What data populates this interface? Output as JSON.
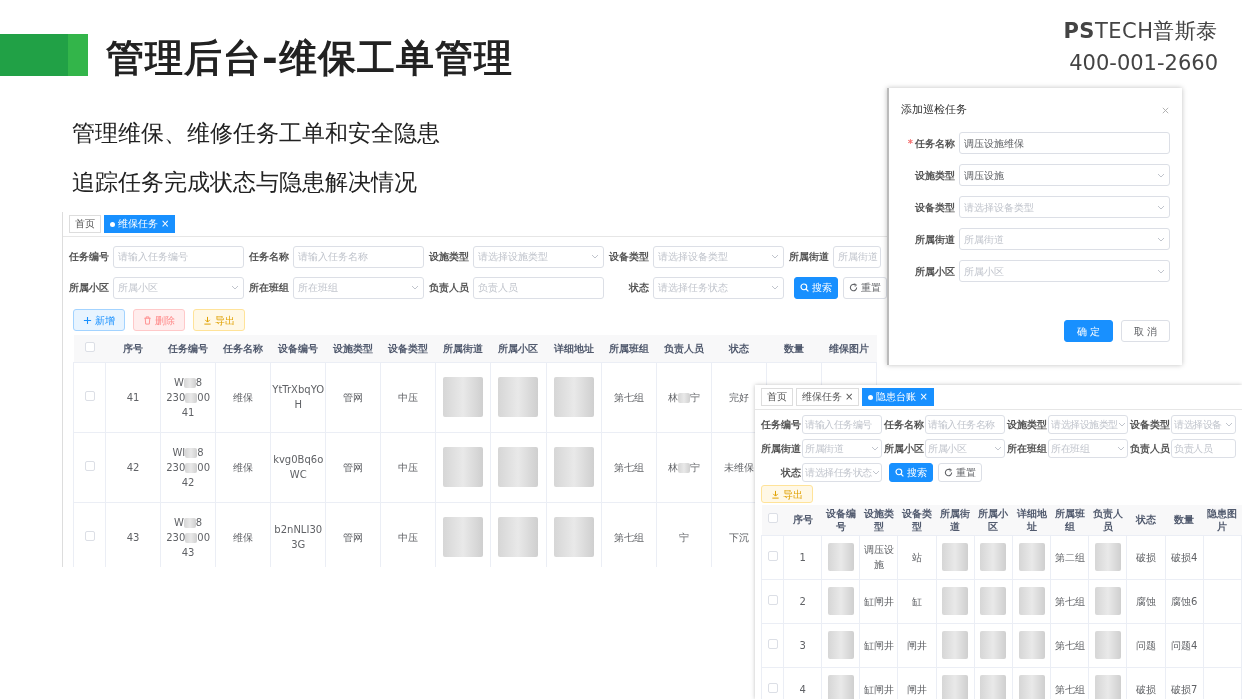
{
  "header": {
    "title": "管理后台-维保工单管理",
    "subtitles": [
      "管理维保、维修任务工单和安全隐患",
      "追踪任务完成状态与隐患解决情况"
    ],
    "logo": "**PS**TECH普斯泰",
    "phone": "400-001-2660"
  },
  "main_screen": {
    "tabs": [
      {
        "label": "首页",
        "selected": false
      },
      {
        "label": "维保任务",
        "selected": true,
        "close": "×"
      }
    ],
    "filter_rows": [
      [
        {
          "kind": "input",
          "label": "任务编号",
          "placeholder": "请输入任务编号"
        },
        {
          "kind": "input",
          "label": "任务名称",
          "placeholder": "请输入任务名称"
        },
        {
          "kind": "select",
          "label": "设施类型",
          "placeholder": "请选择设施类型"
        },
        {
          "kind": "select",
          "label": "设备类型",
          "placeholder": "请选择设备类型"
        },
        {
          "kind": "input",
          "label": "所属街道",
          "placeholder": "所属街道"
        }
      ],
      [
        {
          "kind": "select",
          "label": "所属小区",
          "placeholder": "所属小区"
        },
        {
          "kind": "select",
          "label": "所在班组",
          "placeholder": "所在班组"
        },
        {
          "kind": "input",
          "label": "负责人员",
          "placeholder": "负责人员"
        },
        {
          "kind": "select",
          "label": "状态",
          "placeholder": "请选择任务状态"
        },
        {
          "kind": "search",
          "label": "搜索"
        },
        {
          "kind": "reset",
          "label": "重置"
        }
      ]
    ],
    "actions": [
      {
        "kind": "add",
        "label": "新增"
      },
      {
        "kind": "delete",
        "label": "删除"
      },
      {
        "kind": "export",
        "label": "导出"
      }
    ],
    "table": {
      "select_all_checked": false,
      "columns": [
        "序号",
        "任务编号",
        "任务名称",
        "设备编号",
        "设施类型",
        "设备类型",
        "所属街道",
        "所属小区",
        "详细地址",
        "所属班组",
        "负责人员",
        "状态",
        "数量",
        "维保图片"
      ],
      "rows": [
        {
          "checked": false,
          "cells": [
            "41",
            {
              "lines": [
                [
                  "W",
                  "8"
                ],
                [
                  "230",
                  "00"
                ],
                [
                  "41"
                ]
              ]
            },
            "维保",
            "YtTrXbqYOH",
            "管网",
            "中压",
            {
              "redacted": true
            },
            {
              "redacted": true
            },
            {
              "redacted": true
            },
            "第七组",
            {
              "lines": [
                [
                  "林",
                  "宁"
                ]
              ]
            },
            "完好"
          ]
        },
        {
          "checked": false,
          "cells": [
            "42",
            {
              "lines": [
                [
                  "WI",
                  "8"
                ],
                [
                  "230",
                  "00"
                ],
                [
                  "42"
                ]
              ]
            },
            "维保",
            "kvg0Bq6oWC",
            "管网",
            "中压",
            {
              "redacted": true
            },
            {
              "redacted": true
            },
            {
              "redacted": true
            },
            "第七组",
            {
              "lines": [
                [
                  "林",
                  "宁"
                ]
              ]
            },
            "未维保"
          ]
        },
        {
          "checked": false,
          "cells": [
            "43",
            {
              "lines": [
                [
                  "W",
                  "8"
                ],
                [
                  "230",
                  "00"
                ],
                [
                  "43"
                ]
              ]
            },
            "维保",
            "b2nNLI303G",
            "管网",
            "中压",
            {
              "redacted": true
            },
            {
              "redacted": true
            },
            {
              "redacted": true
            },
            "第七组",
            {
              "lines": [
                [
                  "宁"
                ]
              ]
            },
            "下沉"
          ]
        }
      ]
    }
  },
  "dialog": {
    "title": "添加巡检任务",
    "fields": [
      {
        "kind": "input",
        "label": "任务名称",
        "required_mark": "*",
        "value": "调压设施维保"
      },
      {
        "kind": "select",
        "label": "设施类型",
        "value": "调压设施"
      },
      {
        "kind": "select",
        "label": "设备类型",
        "placeholder": "请选择设备类型"
      },
      {
        "kind": "select",
        "label": "所属街道",
        "placeholder": "所属街道"
      },
      {
        "kind": "select",
        "label": "所属小区",
        "placeholder": "所属小区"
      }
    ],
    "buttons": [
      {
        "kind": "primary",
        "label": "确 定"
      },
      {
        "kind": "default",
        "label": "取 消"
      }
    ]
  },
  "hazard_screen": {
    "tabs": [
      {
        "label": "首页",
        "selected": false
      },
      {
        "label": "维保任务",
        "selected": false,
        "close": "×"
      },
      {
        "label": "隐患台账",
        "selected": true,
        "close": "×"
      }
    ],
    "filter_rows": [
      [
        {
          "kind": "input",
          "label": "任务编号",
          "placeholder": "请输入任务编号"
        },
        {
          "kind": "input",
          "label": "任务名称",
          "placeholder": "请输入任务名称"
        },
        {
          "kind": "select",
          "label": "设施类型",
          "placeholder": "请选择设施类型"
        },
        {
          "kind": "select",
          "label": "设备类型",
          "placeholder": "请选择设备"
        }
      ],
      [
        {
          "kind": "select",
          "label": "所属街道",
          "placeholder": "所属街道"
        },
        {
          "kind": "select",
          "label": "所属小区",
          "placeholder": "所属小区"
        },
        {
          "kind": "select",
          "label": "所在班组",
          "placeholder": "所在班组"
        },
        {
          "kind": "input",
          "label": "负责人员",
          "placeholder": "负责人员"
        }
      ],
      [
        {
          "kind": "select",
          "label": "状态",
          "placeholder": "请选择任务状态"
        },
        {
          "kind": "search",
          "label": "搜索"
        },
        {
          "kind": "reset",
          "label": "重置"
        }
      ]
    ],
    "actions": [
      {
        "kind": "export",
        "label": "导出"
      }
    ],
    "table": {
      "select_all_checked": false,
      "columns": [
        "序号",
        "设备编号",
        "设施类型",
        "设备类型",
        "所属街道",
        "所属小区",
        "详细地址",
        "所属班组",
        "负责人员",
        "状态",
        "数量",
        "隐患图片"
      ],
      "rows": [
        {
          "checked": false,
          "cells": [
            "1",
            {
              "redacted": true
            },
            "调压设施",
            "站",
            {
              "redacted": true
            },
            {
              "redacted": true
            },
            {
              "redacted": true
            },
            "第二组",
            {
              "redacted": true
            },
            "破损",
            "破损4"
          ]
        },
        {
          "checked": false,
          "cells": [
            "2",
            {
              "redacted": true
            },
            "缸闸井",
            "缸",
            {
              "redacted": true
            },
            {
              "redacted": true
            },
            {
              "redacted": true
            },
            "第七组",
            {
              "redacted": true
            },
            "腐蚀",
            "腐蚀6"
          ]
        },
        {
          "checked": false,
          "cells": [
            "3",
            {
              "redacted": true
            },
            "缸闸井",
            "闸井",
            {
              "redacted": true
            },
            {
              "redacted": true
            },
            {
              "redacted": true
            },
            "第七组",
            {
              "redacted": true
            },
            "问题",
            "问题4"
          ]
        },
        {
          "checked": false,
          "cells": [
            "4",
            {
              "redacted": true
            },
            "缸闸井",
            "闸井",
            {
              "redacted": true
            },
            {
              "redacted": true
            },
            {
              "redacted": true
            },
            "第七组",
            {
              "redacted": true
            },
            "破损",
            "破损7"
          ]
        }
      ]
    }
  }
}
